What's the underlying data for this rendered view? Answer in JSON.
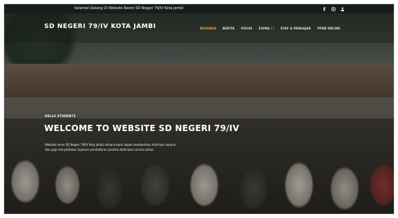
{
  "topbar": {
    "message": "Selamat Datang Di Website Resmi SD Negeri 79/IV Kota Jambi",
    "icons": [
      "facebook-icon",
      "instagram-icon",
      "user-icon"
    ]
  },
  "header": {
    "brand": "SD NEGERI 79/IV KOTA JAMBI"
  },
  "nav": {
    "items": [
      {
        "label": "BERANDA",
        "active": true
      },
      {
        "label": "BERITA",
        "active": false
      },
      {
        "label": "VISIUS",
        "active": false
      },
      {
        "label": "SISWA / /",
        "active": false
      },
      {
        "label": "STAF & PENGAJAR",
        "active": false
      },
      {
        "label": "PPDB ONLINE",
        "active": false
      }
    ]
  },
  "hero": {
    "kicker": "HELLO STUDENTS",
    "title": "WELCOME TO WEBSITE SD NEGERI 79/IV",
    "description": "Website resmi SD Negeri 79/IV Kota Jambi dimana kami dapat memberikan informasi seputar dan juga menyediakan layanan pendaftaran peserta didik baru secara online."
  },
  "colors": {
    "accent": "#e8a53a",
    "topbar_bg": "#161d1a"
  }
}
